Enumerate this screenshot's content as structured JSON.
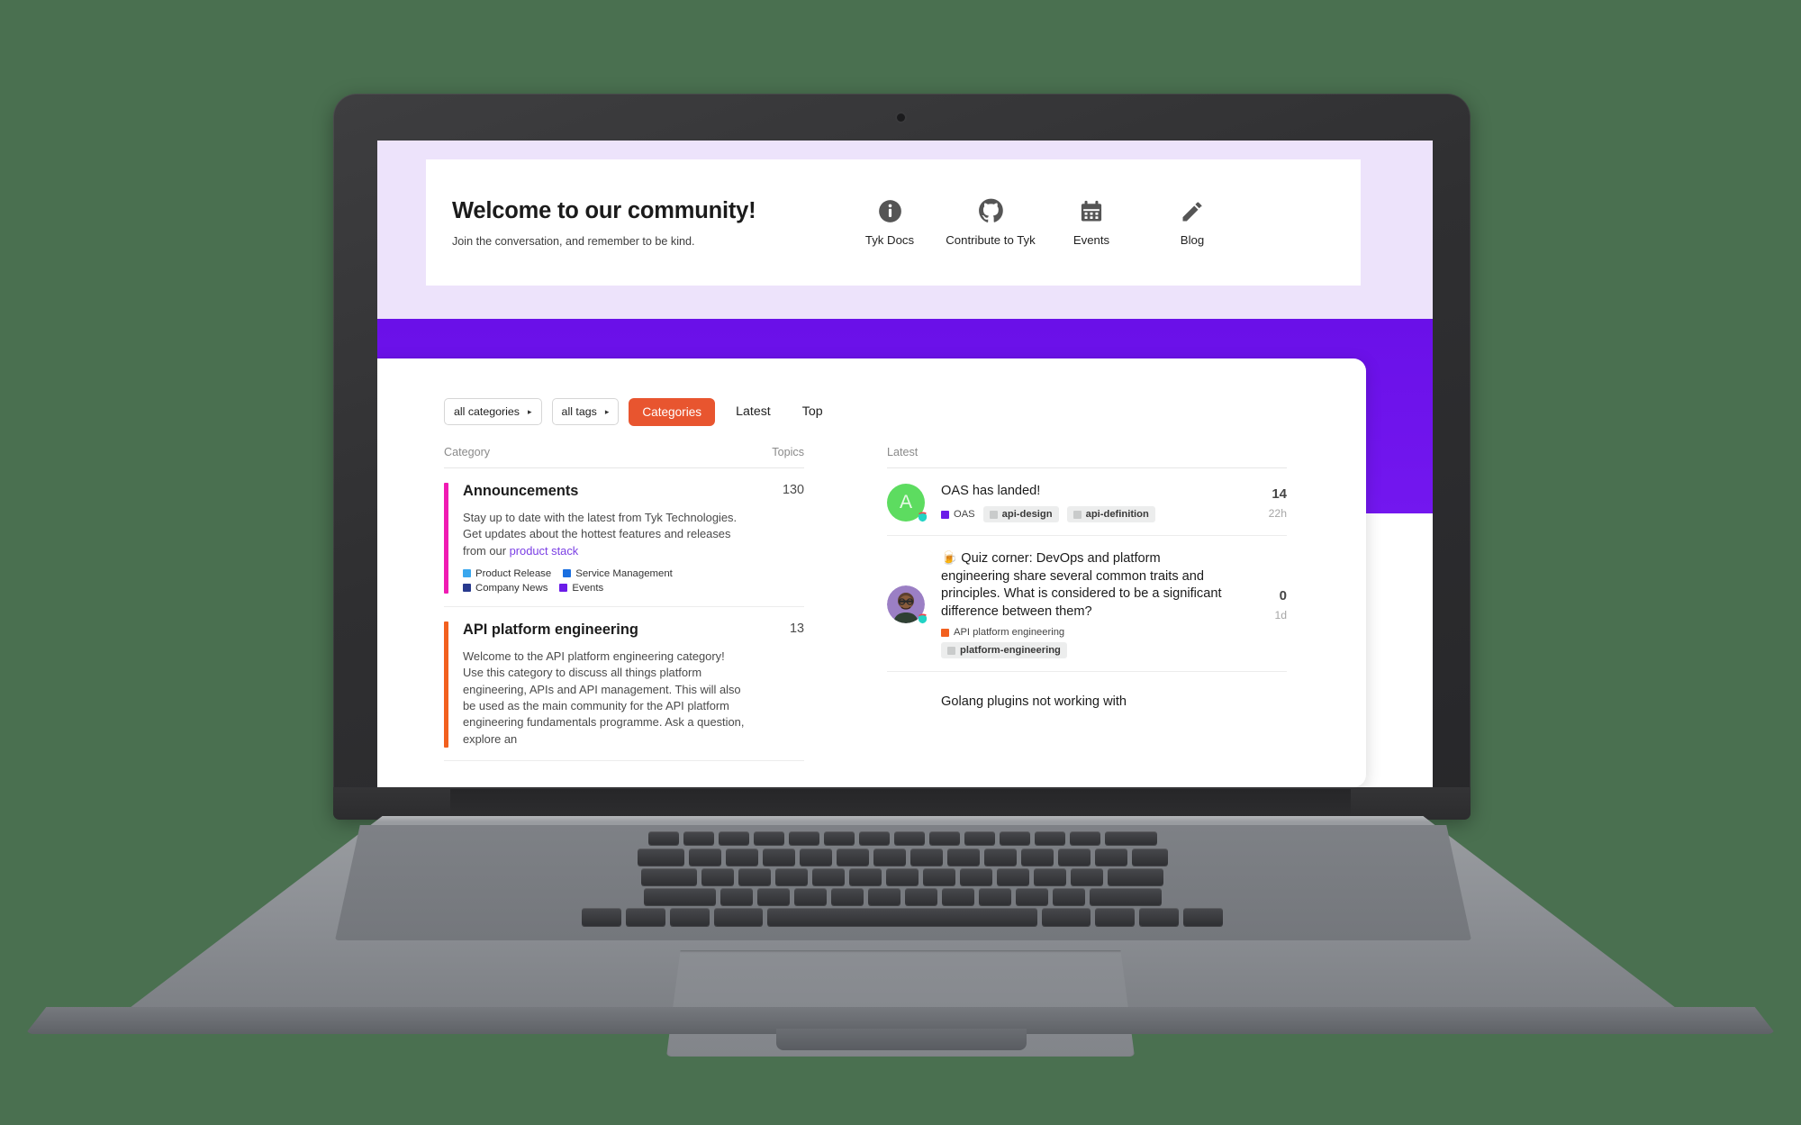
{
  "theme": {
    "background": "#4a7050",
    "lilac_band": "#ede3fb",
    "purple_band": "#6a10e8",
    "accent_orange": "#e8552f",
    "link_purple": "#7b3fe4"
  },
  "hero": {
    "title": "Welcome to our community!",
    "subtitle": "Join the conversation, and remember to be kind.",
    "nav": [
      {
        "label": "Tyk Docs",
        "icon": "info-icon"
      },
      {
        "label": "Contribute to Tyk",
        "icon": "github-icon"
      },
      {
        "label": "Events",
        "icon": "calendar-icon"
      },
      {
        "label": "Blog",
        "icon": "pencil-icon"
      }
    ]
  },
  "filters": {
    "category_select": {
      "label": "all categories",
      "caret": "▸"
    },
    "tag_select": {
      "label": "all tags",
      "caret": "▸"
    },
    "views": [
      {
        "label": "Categories",
        "active": true
      },
      {
        "label": "Latest",
        "active": false
      },
      {
        "label": "Top",
        "active": false
      }
    ]
  },
  "categories_panel": {
    "header_left": "Category",
    "header_right": "Topics",
    "rows": [
      {
        "name": "Announcements",
        "count": "130",
        "bar_color": "#f01bb3",
        "description_lead": "Stay up to date with the latest from Tyk Technologies. Get updates about the hottest features and releases from our ",
        "description_link": "product stack",
        "subcategories": [
          {
            "label": "Product Release",
            "color": "#3aa7ee"
          },
          {
            "label": "Service Management",
            "color": "#1a6fe0"
          },
          {
            "label": "Company News",
            "color": "#283a8e"
          },
          {
            "label": "Events",
            "color": "#6b1ce8"
          }
        ]
      },
      {
        "name": "API platform engineering",
        "count": "13",
        "bar_color": "#f2601f",
        "description_lead": "Welcome to the API platform engineering category! Use this category to discuss all things platform engineering, APIs and API management. This will also be used as the main community for the API platform engineering fundamentals programme. Ask a question, explore an",
        "description_link": "",
        "subcategories": []
      }
    ]
  },
  "latest_panel": {
    "header": "Latest",
    "topics": [
      {
        "title": "OAS has landed!",
        "avatar_letter": "A",
        "avatar_color": "#5ddc60",
        "avatar_type": "letter",
        "count": "14",
        "time": "22h",
        "category_tag": {
          "label": "OAS",
          "color": "#6b1ce8"
        },
        "tags": [
          "api-design",
          "api-definition"
        ]
      },
      {
        "title": "🍺 Quiz corner: DevOps and platform engineering share several common traits and principles. What is considered to be a significant difference between them?",
        "avatar_letter": "",
        "avatar_color": "#9b7fc4",
        "avatar_type": "photo",
        "count": "0",
        "time": "1d",
        "category_tag": {
          "label": "API platform engineering",
          "color": "#f2601f"
        },
        "tags": [
          "platform-engineering"
        ]
      },
      {
        "title": "Golang plugins not working with",
        "avatar_letter": "",
        "avatar_color": "#cccccc",
        "avatar_type": "none",
        "count": "",
        "time": "",
        "category_tag": {
          "label": "",
          "color": ""
        },
        "tags": []
      }
    ]
  }
}
